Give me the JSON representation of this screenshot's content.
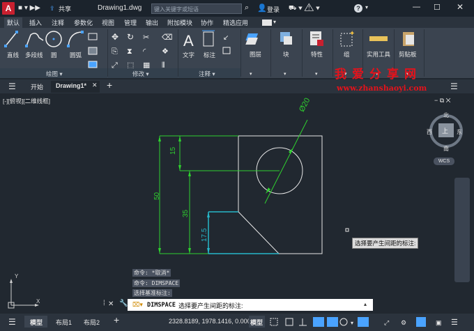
{
  "titlebar": {
    "logo": "A",
    "share": "共享",
    "doc_title": "Drawing1.dwg",
    "search_placeholder": "键入关键字或短语",
    "login": "登录",
    "help": "?"
  },
  "ribbon_tabs": [
    "默认",
    "插入",
    "注释",
    "参数化",
    "视图",
    "管理",
    "输出",
    "附加模块",
    "协作",
    "精选应用"
  ],
  "ribbon": {
    "draw": {
      "items": [
        "直线",
        "多段线",
        "圆",
        "圆弧"
      ],
      "title": "绘图"
    },
    "modify": {
      "title": "修改"
    },
    "annotation": {
      "items": [
        "文字",
        "标注"
      ],
      "title": "注释"
    },
    "layers": "图层",
    "block": "块",
    "properties": "特性",
    "groups": "组",
    "utilities": "实用工具",
    "clipboard": "剪贴板"
  },
  "doc_tabs": {
    "start": "开始",
    "drawing": "Drawing1*"
  },
  "viewport_label": "[-][俯视][二维线框]",
  "viewcube": {
    "north": "北",
    "south": "南",
    "east": "东",
    "west": "西",
    "face": "上",
    "wcs": "WCS"
  },
  "dimensions": {
    "d20": "Ø20",
    "d15": "15",
    "d50": "50",
    "d35": "35",
    "d17_5": "17.5"
  },
  "tooltip": "选择要产生间距的标注:",
  "command_history": [
    "命令: *取消*",
    "命令: DIMSPACE",
    "选择基准标注:"
  ],
  "command_line": {
    "cmd": "DIMSPACE",
    "prompt": "选择要产生间距的标注:"
  },
  "ucs": {
    "x": "X",
    "y": "Y"
  },
  "status": {
    "model_tab": "模型",
    "layout1": "布局1",
    "layout2": "布局2",
    "coords": "2328.8189, 1978.1416, 0.0000",
    "model": "模型"
  },
  "watermark": {
    "title": "我爱分享网",
    "url": "www.zhanshaoyi.com"
  },
  "colors": {
    "accent_green": "#2fd12f",
    "accent_cyan": "#27b7c9",
    "logo_red": "#c8202f",
    "watermark_red": "#e5121b"
  }
}
